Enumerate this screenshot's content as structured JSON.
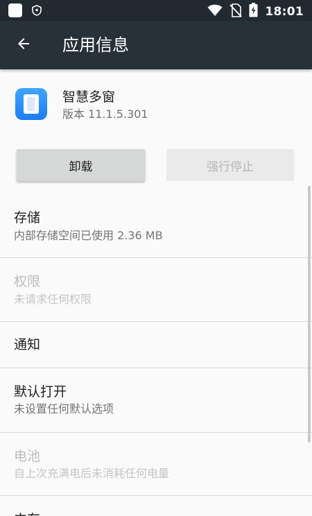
{
  "status_bar": {
    "time": "18:01"
  },
  "toolbar": {
    "title": "应用信息"
  },
  "app": {
    "name": "智慧多窗",
    "version": "版本 11.1.5.301"
  },
  "buttons": {
    "uninstall": "卸载",
    "force_stop": "强行停止"
  },
  "items": [
    {
      "title": "存储",
      "subtitle": "内部存储空间已使用 2.36 MB",
      "enabled": true
    },
    {
      "title": "权限",
      "subtitle": "未请求任何权限",
      "enabled": false
    },
    {
      "title": "通知",
      "subtitle": "",
      "enabled": true
    },
    {
      "title": "默认打开",
      "subtitle": "未设置任何默认选项",
      "enabled": true
    },
    {
      "title": "电池",
      "subtitle": "自上次充满电后未消耗任何电量",
      "enabled": false
    },
    {
      "title": "内存",
      "subtitle": "",
      "enabled": true
    }
  ],
  "colors": {
    "status_bar_bg": "#202a2f",
    "toolbar_bg": "#263238",
    "app_icon_blue": "#1e7cf2"
  },
  "icons": [
    "app-notification-icon",
    "shield-icon",
    "wifi-icon",
    "no-sim-icon",
    "battery-charging-icon",
    "back-arrow-icon",
    "app-icon"
  ]
}
